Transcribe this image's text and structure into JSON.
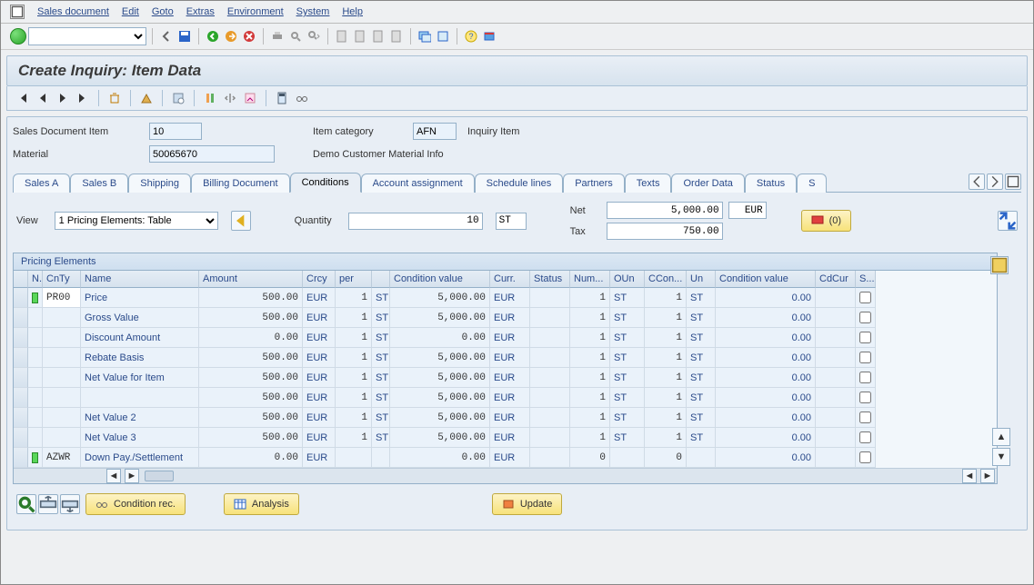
{
  "menu": {
    "items": [
      "Sales document",
      "Edit",
      "Goto",
      "Extras",
      "Environment",
      "System",
      "Help"
    ]
  },
  "title": "Create Inquiry: Item Data",
  "header": {
    "sdi_label": "Sales Document Item",
    "sdi_value": "10",
    "itemcat_label": "Item category",
    "itemcat_value": "AFN",
    "itemcat_text": "Inquiry Item",
    "material_label": "Material",
    "material_value": "50065670",
    "material_text": "Demo Customer Material Info"
  },
  "tabs": [
    "Sales A",
    "Sales B",
    "Shipping",
    "Billing Document",
    "Conditions",
    "Account assignment",
    "Schedule lines",
    "Partners",
    "Texts",
    "Order Data",
    "Status",
    "S"
  ],
  "tabs_active": 4,
  "cond": {
    "view_label": "View",
    "view_value": "1 Pricing Elements: Table",
    "qty_label": "Quantity",
    "qty_value": "10",
    "qty_unit": "ST",
    "net_label": "Net",
    "net_value": "5,000.00",
    "net_curr": "EUR",
    "tax_label": "Tax",
    "tax_value": "750.00",
    "active_badge": "(0)"
  },
  "grid": {
    "title": "Pricing Elements",
    "cols": [
      "N..",
      "CnTy",
      "Name",
      "Amount",
      "Crcy",
      "per",
      "",
      "Condition value",
      "Curr.",
      "Status",
      "Num...",
      "OUn",
      "CCon...",
      "Un",
      "Condition value",
      "CdCur",
      "S..."
    ],
    "rows": [
      {
        "led": true,
        "cnty": "PR00",
        "name": "Price",
        "amount": "500.00",
        "crcy": "EUR",
        "per": "1",
        "pu": "ST",
        "cval": "5,000.00",
        "curr": "EUR",
        "num": "1",
        "oun": "ST",
        "ccon": "1",
        "un": "ST",
        "cval2": "0.00",
        "cb": false,
        "editable": true
      },
      {
        "led": false,
        "cnty": "",
        "name": "Gross Value",
        "amount": "500.00",
        "crcy": "EUR",
        "per": "1",
        "pu": "ST",
        "cval": "5,000.00",
        "curr": "EUR",
        "num": "1",
        "oun": "ST",
        "ccon": "1",
        "un": "ST",
        "cval2": "0.00",
        "cb": false
      },
      {
        "led": false,
        "cnty": "",
        "name": "Discount Amount",
        "amount": "0.00",
        "crcy": "EUR",
        "per": "1",
        "pu": "ST",
        "cval": "0.00",
        "curr": "EUR",
        "num": "1",
        "oun": "ST",
        "ccon": "1",
        "un": "ST",
        "cval2": "0.00",
        "cb": false
      },
      {
        "led": false,
        "cnty": "",
        "name": "Rebate Basis",
        "amount": "500.00",
        "crcy": "EUR",
        "per": "1",
        "pu": "ST",
        "cval": "5,000.00",
        "curr": "EUR",
        "num": "1",
        "oun": "ST",
        "ccon": "1",
        "un": "ST",
        "cval2": "0.00",
        "cb": false
      },
      {
        "led": false,
        "cnty": "",
        "name": "Net Value for Item",
        "amount": "500.00",
        "crcy": "EUR",
        "per": "1",
        "pu": "ST",
        "cval": "5,000.00",
        "curr": "EUR",
        "num": "1",
        "oun": "ST",
        "ccon": "1",
        "un": "ST",
        "cval2": "0.00",
        "cb": false
      },
      {
        "led": false,
        "cnty": "",
        "name": "",
        "amount": "500.00",
        "crcy": "EUR",
        "per": "1",
        "pu": "ST",
        "cval": "5,000.00",
        "curr": "EUR",
        "num": "1",
        "oun": "ST",
        "ccon": "1",
        "un": "ST",
        "cval2": "0.00",
        "cb": false
      },
      {
        "led": false,
        "cnty": "",
        "name": "Net Value 2",
        "amount": "500.00",
        "crcy": "EUR",
        "per": "1",
        "pu": "ST",
        "cval": "5,000.00",
        "curr": "EUR",
        "num": "1",
        "oun": "ST",
        "ccon": "1",
        "un": "ST",
        "cval2": "0.00",
        "cb": false
      },
      {
        "led": false,
        "cnty": "",
        "name": "Net Value 3",
        "amount": "500.00",
        "crcy": "EUR",
        "per": "1",
        "pu": "ST",
        "cval": "5,000.00",
        "curr": "EUR",
        "num": "1",
        "oun": "ST",
        "ccon": "1",
        "un": "ST",
        "cval2": "0.00",
        "cb": false
      },
      {
        "led": true,
        "cnty": "AZWR",
        "name": "Down Pay./Settlement",
        "amount": "0.00",
        "crcy": "EUR",
        "per": "",
        "pu": "",
        "cval": "0.00",
        "curr": "EUR",
        "num": "0",
        "oun": "",
        "ccon": "0",
        "un": "",
        "cval2": "0.00",
        "cb": false
      }
    ]
  },
  "footer": {
    "cond_rec": "Condition rec.",
    "analysis": "Analysis",
    "update": "Update"
  }
}
